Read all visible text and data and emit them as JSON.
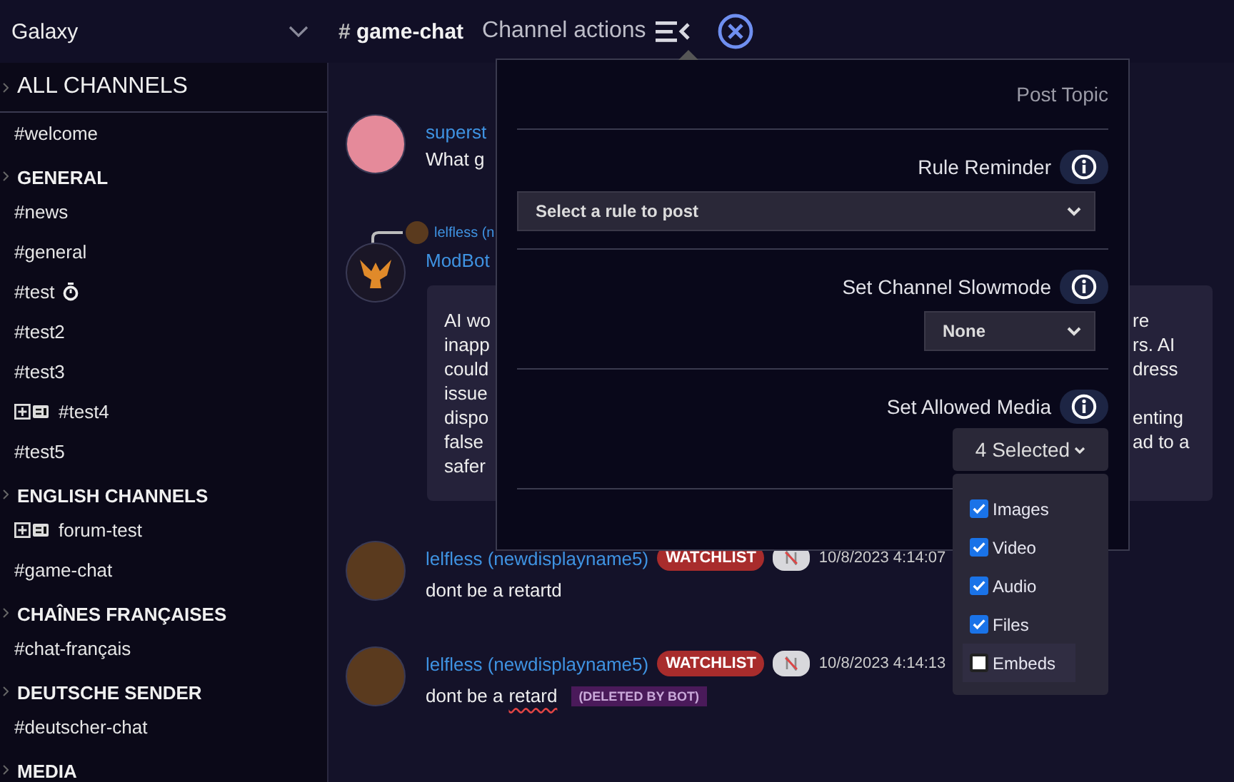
{
  "server": {
    "name": "Galaxy"
  },
  "channel_header": {
    "hash": "#",
    "name": "game-chat",
    "actions_label": "Channel actions"
  },
  "sidebar": {
    "title": "ALL CHANNELS",
    "items": [
      {
        "kind": "channel",
        "label": "#welcome"
      },
      {
        "kind": "category",
        "label": "GENERAL"
      },
      {
        "kind": "channel",
        "label": "#news"
      },
      {
        "kind": "channel",
        "label": "#general"
      },
      {
        "kind": "slowmode",
        "label": "#test"
      },
      {
        "kind": "channel",
        "label": "#test2"
      },
      {
        "kind": "channel",
        "label": "#test3"
      },
      {
        "kind": "forum",
        "label": "#test4"
      },
      {
        "kind": "channel",
        "label": "#test5"
      },
      {
        "kind": "category",
        "label": "ENGLISH CHANNELS"
      },
      {
        "kind": "forum",
        "label": "forum-test"
      },
      {
        "kind": "channel",
        "label": "#game-chat"
      },
      {
        "kind": "category",
        "label": "CHAÎNES FRANÇAISES"
      },
      {
        "kind": "channel",
        "label": "#chat-français"
      },
      {
        "kind": "category",
        "label": "DEUTSCHE SENDER"
      },
      {
        "kind": "channel",
        "label": "#deutscher-chat"
      },
      {
        "kind": "category",
        "label": "MEDIA"
      }
    ]
  },
  "messages": [
    {
      "kind": "plain",
      "author": "superst",
      "text": "What g"
    },
    {
      "kind": "bot_reply",
      "reply_to": "lelfless (n",
      "author": "ModBot",
      "card_rows": [
        {
          "left": "AI wo",
          "right": "re"
        },
        {
          "left": "inapp",
          "right": "rs. AI"
        },
        {
          "left": "could",
          "right": "dress"
        },
        {
          "left": "issue"
        },
        {
          "left": "dispo",
          "right": "enting"
        },
        {
          "left": "false",
          "right": "ad to a"
        },
        {
          "left": "safer"
        }
      ]
    },
    {
      "kind": "flagged",
      "author": "lelfless (newdisplayname5)",
      "badge": "WATCHLIST",
      "timestamp": "10/8/2023 4:14:07",
      "text": "dont be a retartd"
    },
    {
      "kind": "flagged",
      "author": "lelfless (newdisplayname5)",
      "badge": "WATCHLIST",
      "timestamp": "10/8/2023 4:14:13",
      "text": "dont be a",
      "flagged_word": "retard",
      "deleted_tag": "(DELETED BY BOT)"
    }
  ],
  "channel_actions": {
    "post_topic": "Post Topic",
    "sections": [
      {
        "kind": "wide_select",
        "label": "Rule Reminder",
        "value": "Select a rule to post"
      },
      {
        "kind": "select",
        "label": "Set Channel Slowmode",
        "value": "None"
      },
      {
        "kind": "multiselect",
        "label": "Set Allowed Media",
        "value": "4 Selected",
        "options": [
          {
            "label": "Images",
            "checked": true,
            "highlighted": false
          },
          {
            "label": "Video",
            "checked": true,
            "highlighted": false
          },
          {
            "label": "Audio",
            "checked": true,
            "highlighted": false
          },
          {
            "label": "Files",
            "checked": true,
            "highlighted": false
          },
          {
            "label": "Embeds",
            "checked": false,
            "highlighted": true
          }
        ]
      }
    ]
  }
}
